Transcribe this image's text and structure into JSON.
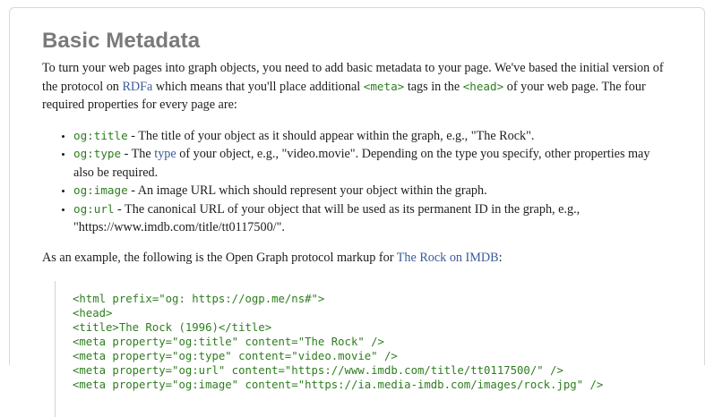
{
  "heading": "Basic Metadata",
  "intro": {
    "part1": "To turn your web pages into graph objects, you need to add basic metadata to your page. We've based the initial version of the protocol on ",
    "rdfa_link": "RDFa",
    "part2": " which means that you'll place additional ",
    "meta_tag": "<meta>",
    "part3": " tags in the ",
    "head_tag": "<head>",
    "part4": " of your web page. The four required properties for every page are:"
  },
  "properties": [
    {
      "code": "og:title",
      "text": " - The title of your object as it should appear within the graph, e.g., \"The Rock\"."
    },
    {
      "code": "og:type",
      "pre": " - The ",
      "link": "type",
      "text": " of your object, e.g., \"video.movie\". Depending on the type you specify, other properties may also be required."
    },
    {
      "code": "og:image",
      "text": " - An image URL which should represent your object within the graph."
    },
    {
      "code": "og:url",
      "text": " - The canonical URL of your object that will be used as its permanent ID in the graph, e.g., \"https://www.imdb.com/title/tt0117500/\"."
    }
  ],
  "example": {
    "text": "As an example, the following is the Open Graph protocol markup for ",
    "link": "The Rock on IMDB",
    "suffix": ":"
  },
  "code_lines": [
    "<html prefix=\"og: https://ogp.me/ns#\">",
    "<head>",
    "<title>The Rock (1996)</title>",
    "<meta property=\"og:title\" content=\"The Rock\" />",
    "<meta property=\"og:type\" content=\"video.movie\" />",
    "<meta property=\"og:url\" content=\"https://www.imdb.com/title/tt0117500/\" />",
    "<meta property=\"og:image\" content=\"https://ia.media-imdb.com/images/rock.jpg\" />"
  ],
  "colors": {
    "heading": "#7a7a7a",
    "link": "#3b5b99",
    "code": "#2e7d1f"
  }
}
